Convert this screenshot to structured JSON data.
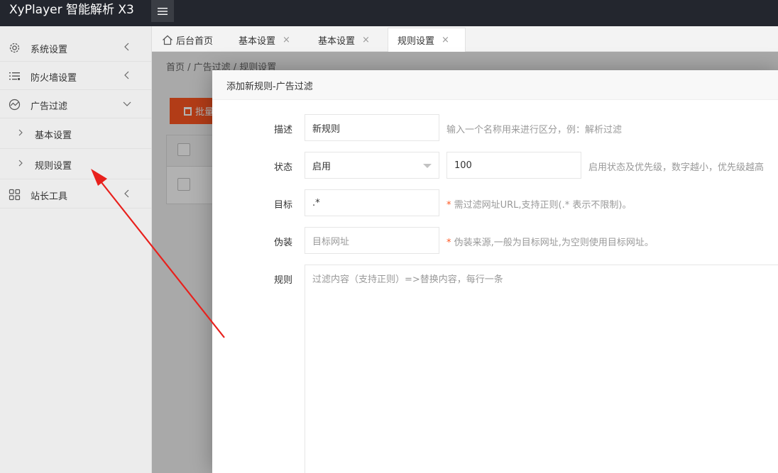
{
  "app": {
    "title": "XyPlayer 智能解析 X3"
  },
  "sidebar": {
    "items": [
      {
        "label": "系统设置",
        "icon": "gear-icon"
      },
      {
        "label": "防火墙设置",
        "icon": "list-icon"
      },
      {
        "label": "广告过滤",
        "icon": "chart-icon"
      },
      {
        "label": "站长工具",
        "icon": "grid-icon"
      }
    ],
    "subitems": [
      {
        "label": "基本设置"
      },
      {
        "label": "规则设置"
      }
    ]
  },
  "tabs": [
    {
      "label": "后台首页",
      "icon": "home-icon"
    },
    {
      "label": "基本设置",
      "close": "×"
    },
    {
      "label": "基本设置",
      "close": "×"
    },
    {
      "label": "规则设置",
      "close": "×"
    }
  ],
  "breadcrumb": {
    "text": "首页  /  广告过滤  /  规则设置"
  },
  "background": {
    "button_label": "批量"
  },
  "dialog": {
    "title": "添加新规则-广告过滤",
    "fields": {
      "desc": {
        "label": "描述",
        "value": "新规则",
        "tip": "输入一个名称用来进行区分，例：解析过滤"
      },
      "status": {
        "label": "状态",
        "selected": "启用",
        "priority": "100",
        "tip": "启用状态及优先级，数字越小，优先级越高"
      },
      "target": {
        "label": "目标",
        "value": ".*",
        "req": "*",
        "tip": " 需过滤网址URL,支持正则(.* 表示不限制)。"
      },
      "disguise": {
        "label": "伪装",
        "placeholder": "目标网址",
        "req": "*",
        "tip": " 伪装来源,一般为目标网址,为空则使用目标网址。"
      },
      "rules": {
        "label": "规则",
        "placeholder": "过滤内容（支持正则）=>替换内容，每行一条"
      }
    }
  },
  "colors": {
    "accent": "#ff5722",
    "topbar": "#23262e",
    "annotation": "#e8201c"
  }
}
